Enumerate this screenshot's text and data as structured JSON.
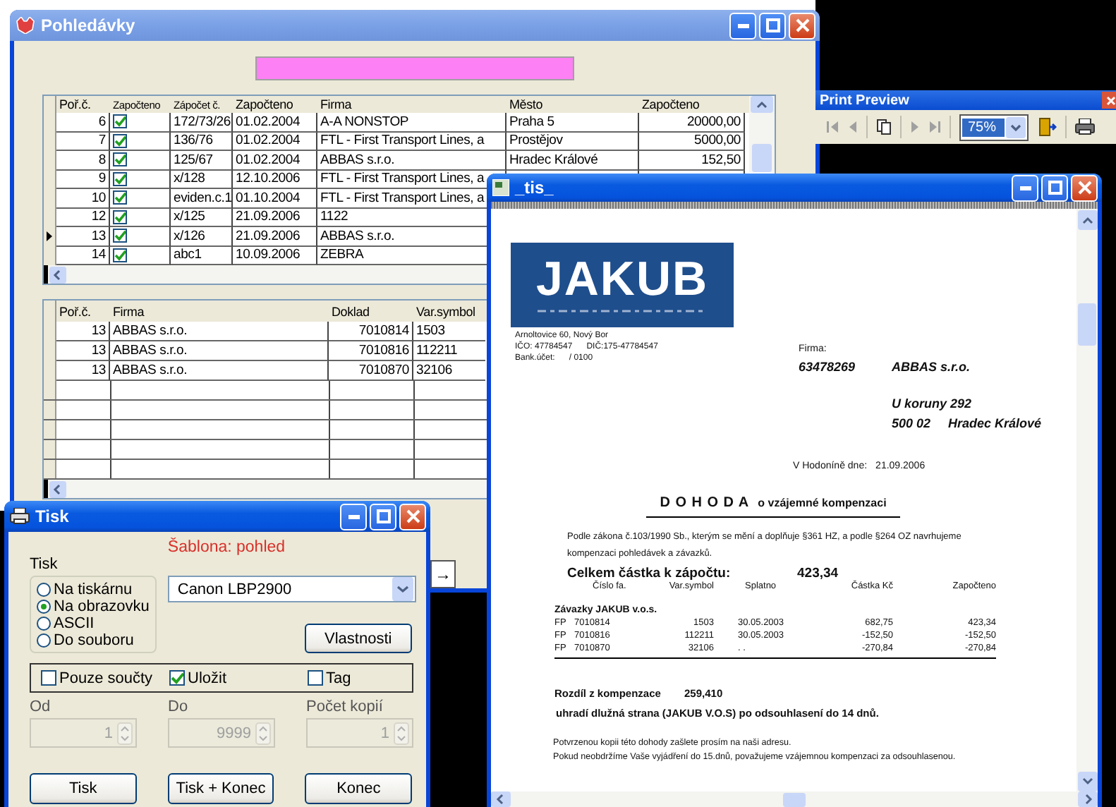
{
  "pohledavky": {
    "title": "Pohledávky",
    "grid1": {
      "columns": [
        "Poř.č.",
        "Započteno",
        "Zápočet č.",
        "Započteno",
        "Firma",
        "Město",
        "Započteno"
      ],
      "rows": [
        {
          "n": "6",
          "checked": true,
          "zapocet": "172/73/26",
          "date": "01.02.2004",
          "firma": "A-A NONSTOP",
          "mesto": "Praha 5",
          "castka": "20000,00",
          "selected": false
        },
        {
          "n": "7",
          "checked": true,
          "zapocet": "136/76",
          "date": "01.02.2004",
          "firma": "FTL - First Transport Lines, a",
          "mesto": "Prostějov",
          "castka": "5000,00",
          "selected": false
        },
        {
          "n": "8",
          "checked": true,
          "zapocet": "125/67",
          "date": "01.02.2004",
          "firma": "ABBAS s.r.o.",
          "mesto": "Hradec Králové",
          "castka": "152,50",
          "selected": false
        },
        {
          "n": "9",
          "checked": true,
          "zapocet": "x/128",
          "date": "12.10.2006",
          "firma": "FTL - First Transport Lines, a",
          "selected": false
        },
        {
          "n": "10",
          "checked": true,
          "zapocet": "eviden.c.1",
          "date": "01.10.2004",
          "firma": "FTL - First Transport Lines, a",
          "selected": false
        },
        {
          "n": "12",
          "checked": true,
          "zapocet": "x/125",
          "date": "21.09.2006",
          "firma": "1122",
          "selected": false
        },
        {
          "n": "13",
          "checked": true,
          "zapocet": "x/126",
          "date": "21.09.2006",
          "firma": "ABBAS s.r.o.",
          "selected": true
        },
        {
          "n": "14",
          "checked": true,
          "zapocet": "abc1",
          "date": "10.09.2006",
          "firma": "ZEBRA",
          "selected": false
        }
      ]
    },
    "grid2": {
      "columns": [
        "Poř.č.",
        "Firma",
        "Doklad",
        "Var.symbol"
      ],
      "rows": [
        {
          "n": "13",
          "firma": "ABBAS s.r.o.",
          "doklad": "7010814",
          "var": "1503"
        },
        {
          "n": "13",
          "firma": "ABBAS s.r.o.",
          "doklad": "7010816",
          "var": "112211"
        },
        {
          "n": "13",
          "firma": "ABBAS s.r.o.",
          "doklad": "7010870",
          "var": "32106"
        }
      ]
    },
    "arrow_button": "→"
  },
  "print_preview": {
    "title": "Print Preview",
    "zoom": "75%"
  },
  "tis": {
    "title": "_tis_",
    "document": {
      "logo": "JAKUB",
      "address": [
        "Arnoltovice 60, Nový Bor"
      ],
      "ico": "IČO: 47784547",
      "dic": "DIČ:175-47784547",
      "bank_label": "Bank.účet:",
      "bank": "/ 0100",
      "firma_label": "Firma:",
      "firma_ico": "63478269",
      "firma_name": "ABBAS s.r.o.",
      "street": "U koruny 292",
      "zip": "500 02",
      "city": "Hradec Králové",
      "date_label": "V Hodoníně dne:",
      "date": "21.09.2006",
      "title": "D O H O D A",
      "subtitle": "o  vzájemné kompenzaci",
      "paragraph": "Podle zákona č.103/1990 Sb., kterým se mění a doplňuje §361 HZ, a podle §264 OZ navrhujeme kompenzaci pohledávek a závazků.",
      "total_label": "Celkem částka k zápočtu:",
      "total": "423,34",
      "columns": [
        "",
        "Číslo fa.",
        "Var.symbol",
        "Splatno",
        "Částka Kč",
        "Započteno"
      ],
      "section": "Závazky JAKUB v.o.s.",
      "rows": [
        [
          "FP",
          "7010814",
          "1503",
          "30.05.2003",
          "682,75",
          "423,34"
        ],
        [
          "FP",
          "7010816",
          "112211",
          "30.05.2003",
          "-152,50",
          "-152,50"
        ],
        [
          "FP",
          "7010870",
          "32106",
          ". .",
          "-270,84",
          "-270,84"
        ]
      ],
      "diff_label": "Rozdíl z kompenzace",
      "diff": "259,410",
      "pay_note": "uhradí dlužná strana (JAKUB V.O.S) po odsouhlasení do 14 dnů.",
      "footer": [
        "Potvrzenou kopii této dohody zašlete prosím na naši adresu.",
        "Pokud neobdržíme Vaše vyjádření do 15.dnů, považujeme vzájemnou kompenzaci za odsouhlasenou."
      ]
    }
  },
  "tisk": {
    "title": "Tisk",
    "template": "Šablona: pohled",
    "group_label": "Tisk",
    "radios": [
      {
        "label": "Na tiskárnu",
        "selected": false
      },
      {
        "label": "Na obrazovku",
        "selected": true
      },
      {
        "label": "ASCII",
        "selected": false
      },
      {
        "label": "Do souboru",
        "selected": false
      }
    ],
    "printer": "Canon LBP2900",
    "properties_button": "Vlastnosti",
    "checkboxes": [
      {
        "label": "Pouze součty",
        "checked": false
      },
      {
        "label": "Uložit",
        "checked": true
      },
      {
        "label": "Tag",
        "checked": false
      }
    ],
    "spins": [
      {
        "label": "Od",
        "value": "1",
        "disabled": true
      },
      {
        "label": "Do",
        "value": "9999",
        "disabled": true
      },
      {
        "label": "Počet kopií",
        "value": "1",
        "disabled": true
      }
    ],
    "buttons": [
      "Tisk",
      "Tisk + Konec",
      "Konec"
    ]
  }
}
